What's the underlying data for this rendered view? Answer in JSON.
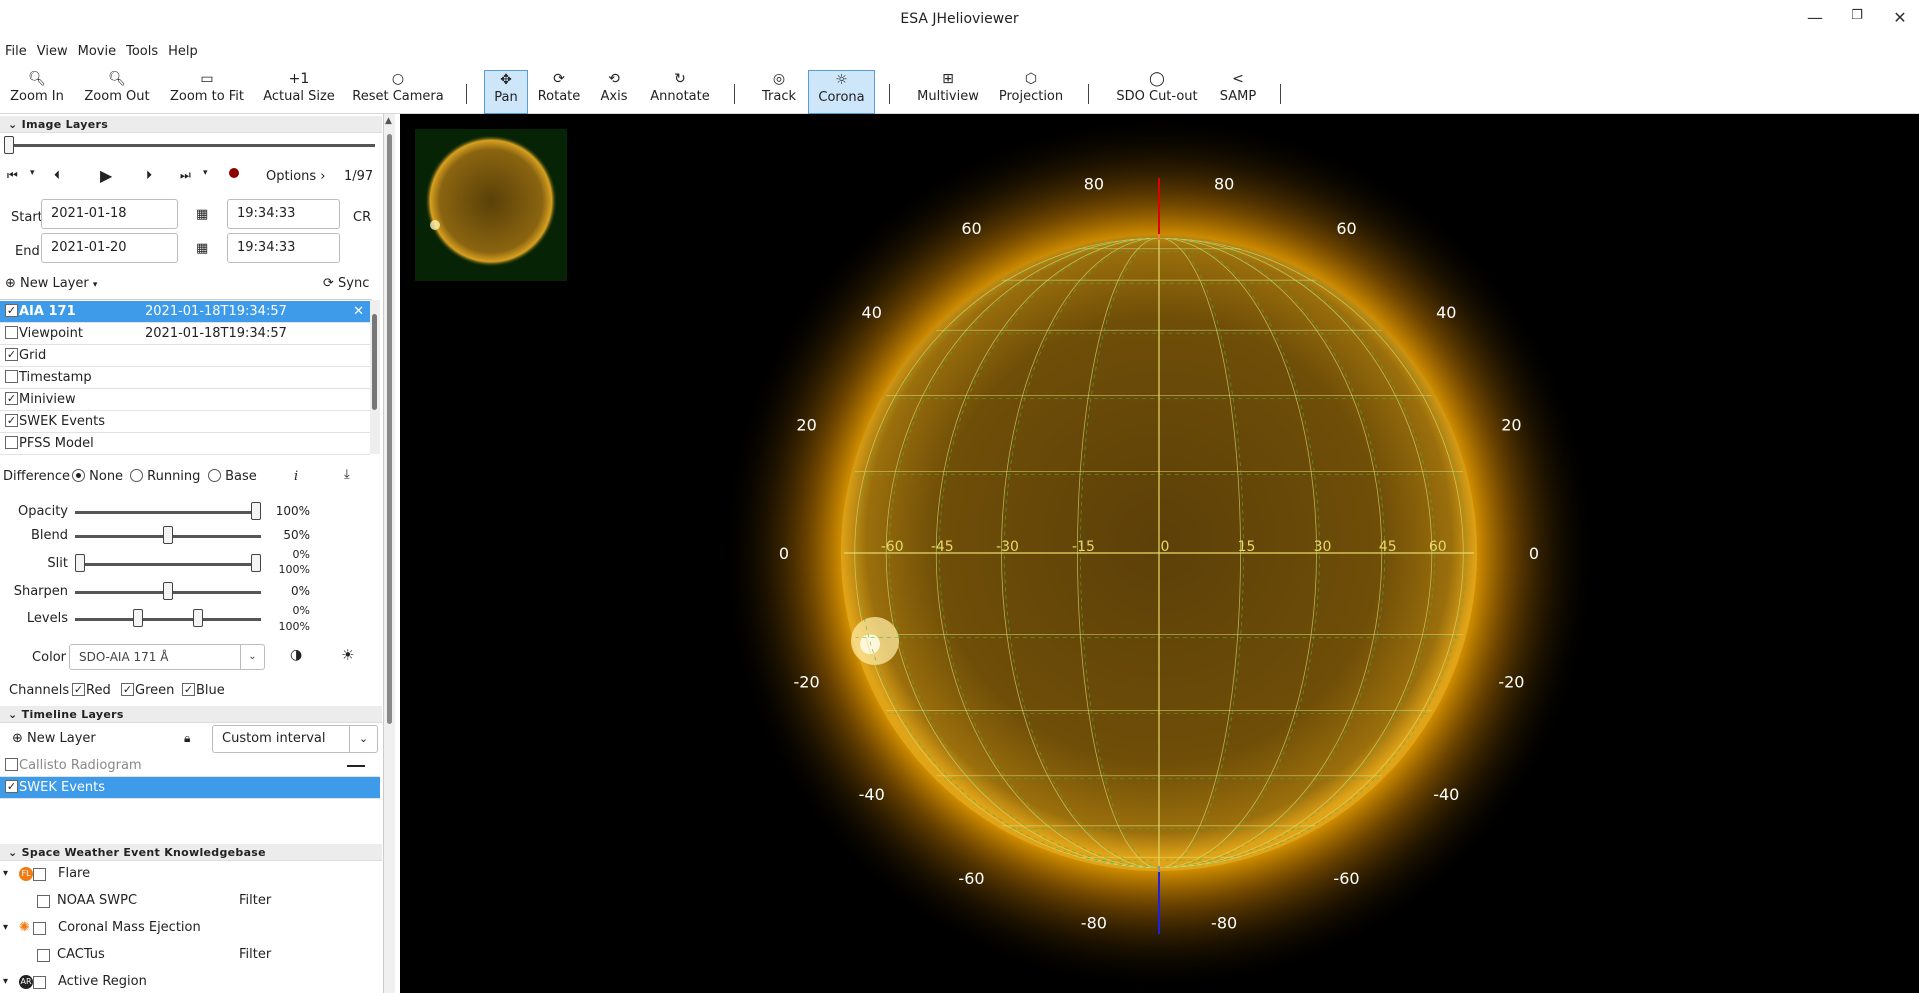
{
  "window": {
    "title": "ESA JHelioviewer"
  },
  "menu": [
    "File",
    "View",
    "Movie",
    "Tools",
    "Help"
  ],
  "toolbar": {
    "zoom_in": "Zoom In",
    "zoom_out": "Zoom Out",
    "zoom_fit": "Zoom to Fit",
    "actual_size": "Actual Size",
    "reset_camera": "Reset Camera",
    "pan": "Pan",
    "rotate": "Rotate",
    "axis": "Axis",
    "annotate": "Annotate",
    "track": "Track",
    "corona": "Corona",
    "multiview": "Multiview",
    "projection": "Projection",
    "sdo_cutout": "SDO Cut-out",
    "samp": "SAMP"
  },
  "image_layers": {
    "heading": "Image Layers",
    "frame_counter": "1/97",
    "frame_progress": 0.0,
    "options_label": "Options ›",
    "start_label": "Start",
    "end_label": "End",
    "start_date": "2021-01-18",
    "start_time": "19:34:33",
    "end_date": "2021-01-20",
    "end_time": "19:34:33",
    "cr_label": "CR",
    "new_layer": "New Layer",
    "sync": "Sync",
    "layers": [
      {
        "name": "AIA 171",
        "time": "2021-01-18T19:34:57",
        "checked": true,
        "selected": true
      },
      {
        "name": "Viewpoint",
        "time": "2021-01-18T19:34:57",
        "checked": false
      },
      {
        "name": "Grid",
        "time": "",
        "checked": true
      },
      {
        "name": "Timestamp",
        "time": "",
        "checked": false
      },
      {
        "name": "Miniview",
        "time": "",
        "checked": true
      },
      {
        "name": "SWEK Events",
        "time": "",
        "checked": true
      },
      {
        "name": "PFSS Model",
        "time": "",
        "checked": false
      }
    ]
  },
  "adjust": {
    "difference_label": "Difference",
    "diff_options": [
      "None",
      "Running",
      "Base"
    ],
    "diff_selected": "None",
    "opacity_label": "Opacity",
    "opacity_value": "100%",
    "opacity": 1.0,
    "blend_label": "Blend",
    "blend_value": "50%",
    "blend": 0.5,
    "slit_label": "Slit",
    "slit_min": "0%",
    "slit_max": "100%",
    "slit_low": 0.0,
    "slit_high": 1.0,
    "sharpen_label": "Sharpen",
    "sharpen_value": "0%",
    "sharpen": 0.5,
    "levels_label": "Levels",
    "levels_min": "0%",
    "levels_max": "100%",
    "levels_low": 0.33,
    "levels_high": 0.67,
    "color_label": "Color",
    "color_value": "SDO-AIA 171 Å",
    "channels_label": "Channels",
    "channels": [
      "Red",
      "Green",
      "Blue"
    ]
  },
  "timeline": {
    "heading": "Timeline Layers",
    "new_layer": "New Layer",
    "interval": "Custom interval",
    "layers": [
      {
        "name": "Callisto Radiogram",
        "checked": false,
        "selected": false
      },
      {
        "name": "SWEK Events",
        "checked": true,
        "selected": true
      }
    ]
  },
  "swek": {
    "heading": "Space Weather Event Knowledgebase",
    "filter_label": "Filter",
    "rows": [
      {
        "name": "Flare",
        "level": 0
      },
      {
        "name": "NOAA SWPC",
        "level": 1,
        "filter": true
      },
      {
        "name": "Coronal Mass Ejection",
        "level": 0
      },
      {
        "name": "CACTus",
        "level": 1,
        "filter": true
      },
      {
        "name": "Active Region",
        "level": 0
      }
    ]
  },
  "viewer": {
    "lat_labels_left": [
      "80",
      "60",
      "40",
      "20",
      "0",
      "-20",
      "-40",
      "-60",
      "-80"
    ],
    "lat_labels_right": [
      "80",
      "60",
      "40",
      "20",
      "0",
      "-20",
      "-40",
      "-60",
      "-80"
    ],
    "lon_labels": [
      "-60",
      "-45",
      "-30",
      "-15",
      "0",
      "15",
      "30",
      "45",
      "60"
    ],
    "colors": {
      "sun_core": "#6b4a05",
      "sun_mid": "#b8860b",
      "corona": "#ffb000",
      "grid": "#e6d96a",
      "grid_green": "#4caf50",
      "axis_top": "#e00000",
      "axis_bottom": "#2020e0",
      "selection": "#3d9be9"
    }
  }
}
